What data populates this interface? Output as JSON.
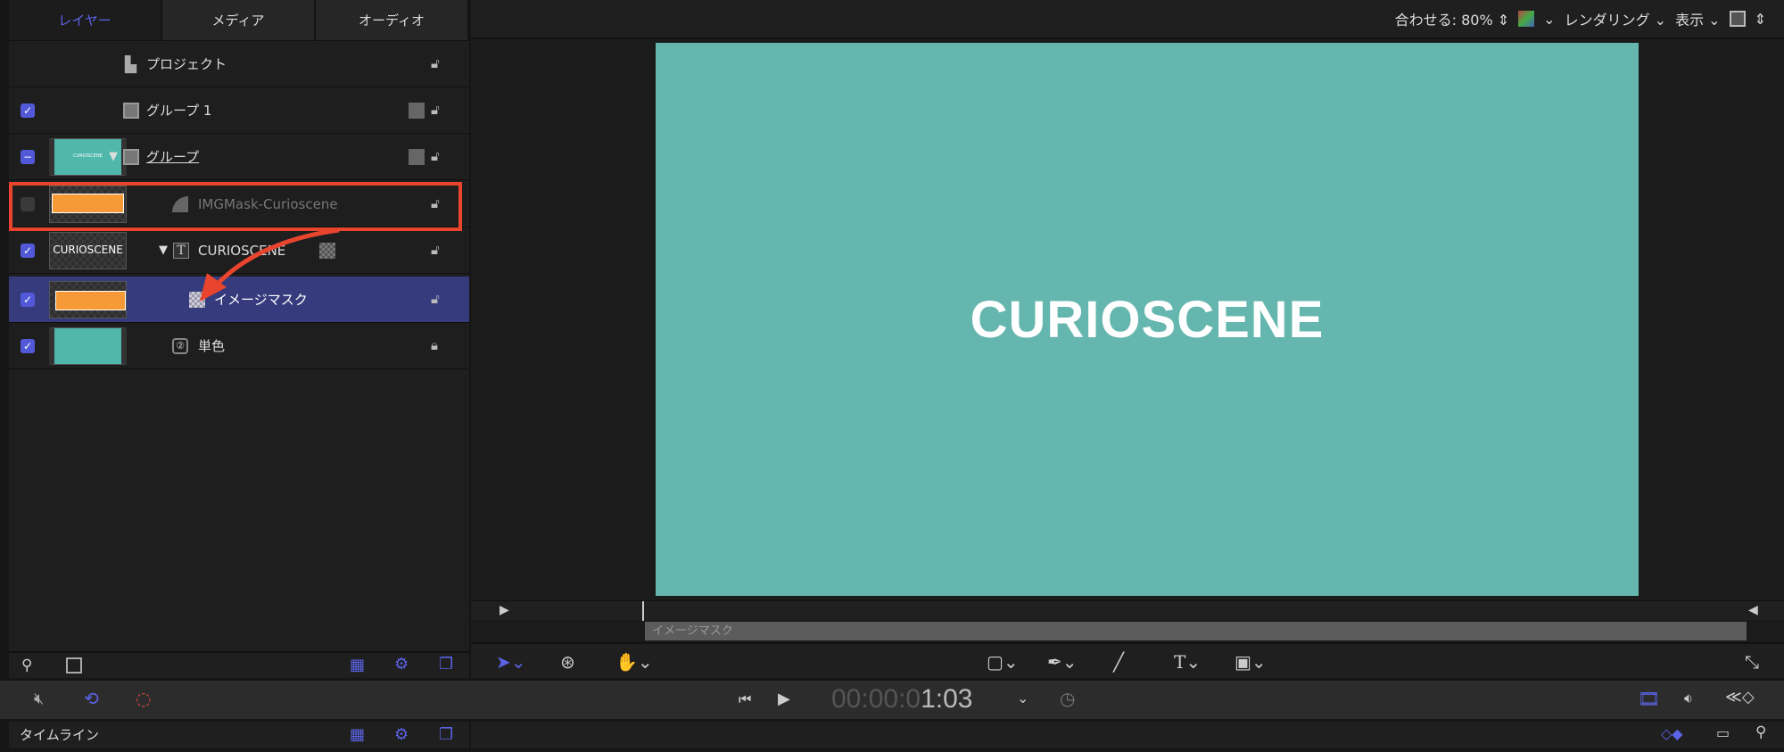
{
  "tabs": [
    {
      "label": "レイヤー",
      "active": true
    },
    {
      "label": "メディア"
    },
    {
      "label": "オーディオ"
    }
  ],
  "layers": [
    {
      "name": "プロジェクト",
      "icon": "document-icon"
    },
    {
      "name": "グループ 1",
      "checked": true,
      "icon": "group-icon"
    },
    {
      "name": "グループ",
      "checked": "mixed",
      "icon": "group-icon",
      "thumb_text": "CURIOSCENE"
    },
    {
      "name": "IMGMask-Curioscene",
      "checked": false,
      "icon": "shape-icon",
      "highlighted": true
    },
    {
      "name": "CURIOSCENE",
      "checked": true,
      "icon": "text-icon",
      "thumb_text": "CURIOSCENE"
    },
    {
      "name": "イメージマスク",
      "checked": true,
      "icon": "image-mask-icon",
      "selected": true
    },
    {
      "name": "単色",
      "checked": true,
      "icon": "generator-icon"
    }
  ],
  "viewer": {
    "fit_label": "合わせる: 80%",
    "render_label": "レンダリング",
    "view_label": "表示",
    "canvas_text": "CURIOSCENE",
    "canvas_color": "#64b6ae"
  },
  "timeline_clip": "イメージマスク",
  "transport": {
    "timecode_dim": "00:00:0",
    "timecode_bright": "1:03"
  },
  "timeline_label": "タイムライン",
  "colors": {
    "accent": "#5b63e6",
    "highlight_box": "#e8442e",
    "selected_row": "#363b7d",
    "mask_orange": "#f59a36"
  }
}
